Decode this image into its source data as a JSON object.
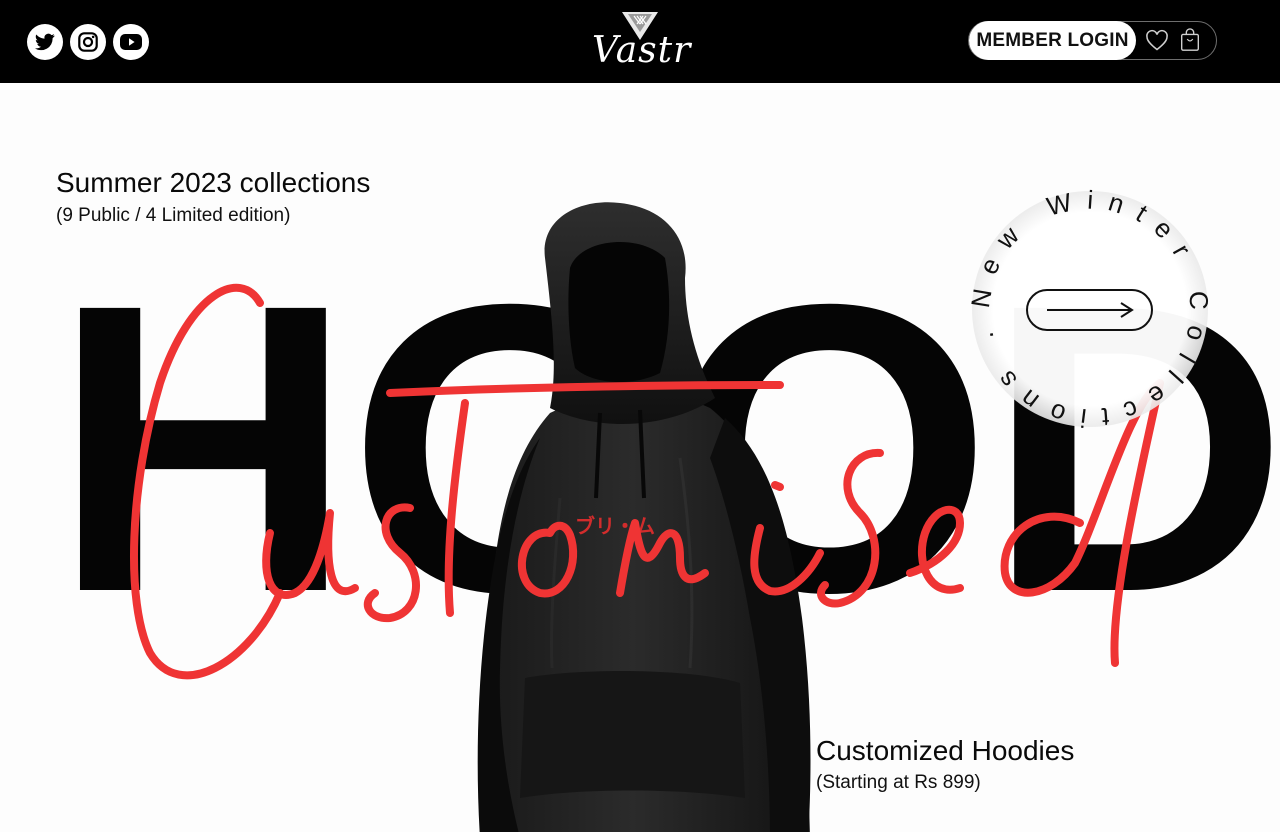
{
  "header": {
    "brand": "Vastr",
    "social": [
      {
        "name": "twitter-icon"
      },
      {
        "name": "instagram-icon"
      },
      {
        "name": "youtube-icon"
      }
    ],
    "login_label": "MEMBER LOGIN"
  },
  "hero": {
    "big_word": "HOODIES",
    "script_word": "Customised",
    "collection_title": "Summer 2023 collections",
    "collection_sub": "(9 Public / 4 Limited edition)",
    "product_title": "Customized Hoodies",
    "product_sub": "(Starting at Rs 899)",
    "badge_text": "New Winter Collections ."
  },
  "colors": {
    "accent_red": "#ef3434",
    "header_bg": "#000000",
    "page_bg": "#fdfdfd"
  }
}
